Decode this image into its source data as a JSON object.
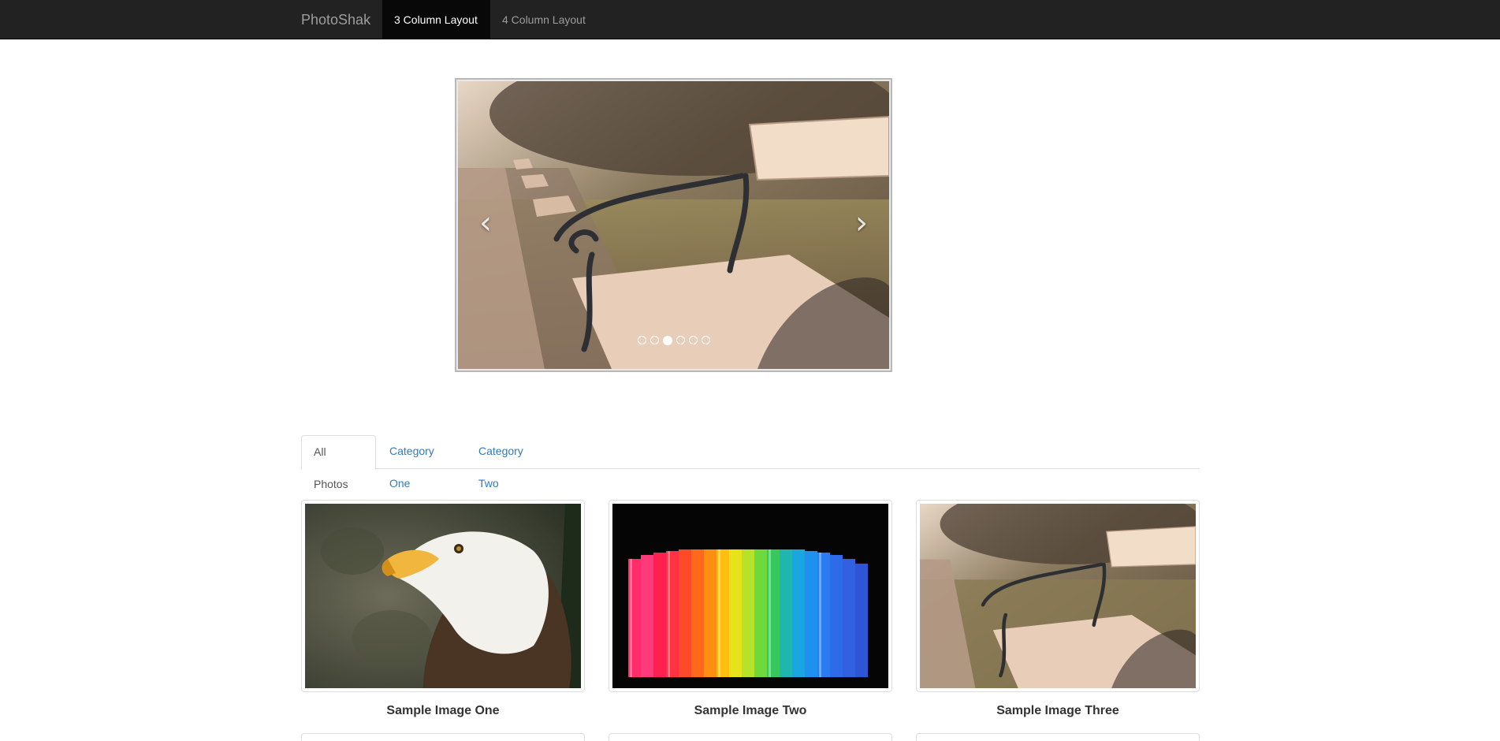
{
  "navbar": {
    "brand": "PhotoShak",
    "links": [
      {
        "label": "3 Column Layout",
        "active": true
      },
      {
        "label": "4 Column Layout",
        "active": false
      }
    ]
  },
  "carousel": {
    "image": "park-bench-photo",
    "prev_icon": "chevron-left-icon",
    "next_icon": "chevron-right-icon",
    "indicator_count": 6,
    "active_index": 2
  },
  "tabs": [
    {
      "label": "All Photos",
      "active": true
    },
    {
      "label": "Category One",
      "active": false
    },
    {
      "label": "Category Two",
      "active": false
    }
  ],
  "gallery": [
    {
      "title": "Sample Image One",
      "image": "bald-eagle-photo"
    },
    {
      "title": "Sample Image Two",
      "image": "colorful-straws-photo"
    },
    {
      "title": "Sample Image Three",
      "image": "park-bench-photo"
    }
  ],
  "colors": {
    "navbar_bg": "#222222",
    "navbar_active_bg": "#080808",
    "link": "#337ab7"
  }
}
